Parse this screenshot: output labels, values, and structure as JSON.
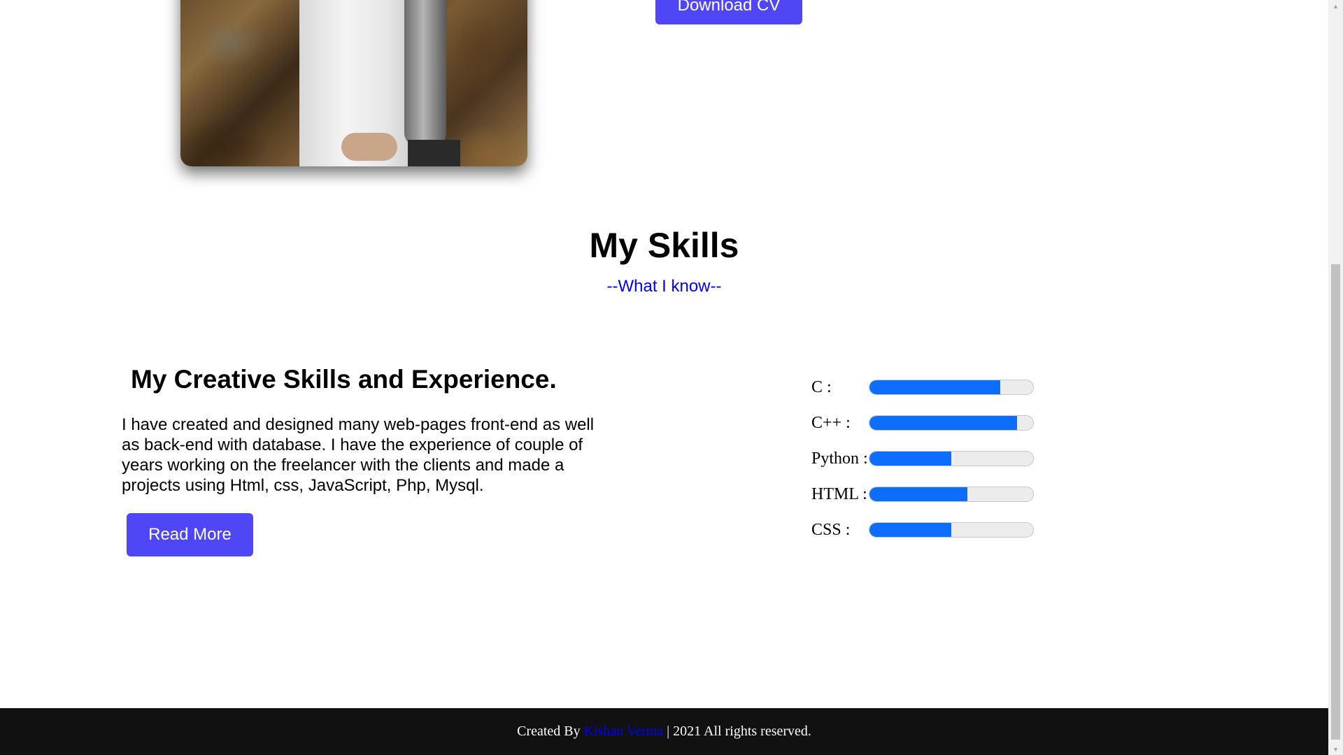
{
  "hero": {
    "download_cv_label": "Download CV"
  },
  "skills_section": {
    "title": "My Skills",
    "subtitle": "--What I know--"
  },
  "about": {
    "heading": "My Creative Skills and Experience.",
    "paragraph": "I have created and designed many web-pages front-end as well as back-end with database. I have the experience of couple of years working on the freelancer with the clients and made a projects using Html, css, JavaScript, Php, Mysql.",
    "read_more_label": "Read More"
  },
  "skills": [
    {
      "label": "C :",
      "level": 0.8
    },
    {
      "label": "C++ :",
      "level": 0.9
    },
    {
      "label": "Python :",
      "level": 0.5
    },
    {
      "label": "HTML :",
      "level": 0.6
    },
    {
      "label": "CSS :",
      "level": 0.5
    }
  ],
  "footer": {
    "prefix": "Created By",
    "author": "Kishan Verma",
    "suffix": "| 2021 All rights reserved."
  },
  "colors": {
    "button": "#4f46f5",
    "progress_fill": "#0d6efd",
    "subtitle": "#0000ff",
    "footer_bg": "#111111"
  }
}
